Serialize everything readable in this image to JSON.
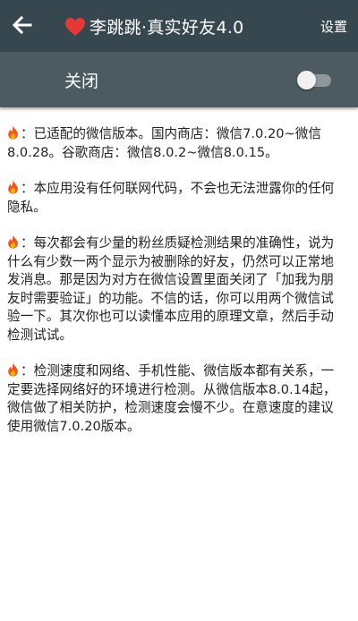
{
  "header": {
    "title": "李跳跳·真实好友4.0",
    "settings_label": "设置",
    "bar_color": "#37474f",
    "heart_color": "#e53935",
    "icons": {
      "back": "arrow-left-icon",
      "title": "heart-icon"
    }
  },
  "switch_bar": {
    "label": "关闭",
    "toggle_on": false
  },
  "notes": [
    {
      "icon": "fire-icon",
      "text": "：已适配的微信版本。国内商店：微信7.0.20~微信8.0.28。谷歌商店：微信8.0.2~微信8.0.15。"
    },
    {
      "icon": "fire-icon",
      "text": "：本应用没有任何联网代码，不会也无法泄露你的任何隐私。"
    },
    {
      "icon": "fire-icon",
      "text": "：每次都会有少量的粉丝质疑检测结果的准确性，说为什么有少数一两个显示为被删除的好友，仍然可以正常地发消息。那是因为对方在微信设置里面关闭了「加我为朋友时需要验证」的功能。不信的话，你可以用两个微信试验一下。其次你也可以读懂本应用的原理文章，然后手动检测试试。"
    },
    {
      "icon": "fire-icon",
      "text": "：检测速度和网络、手机性能、微信版本都有关系，一定要选择网络好的环境进行检测。从微信版本8.0.14起，微信做了相关防护，检测速度会慢不少。在意速度的建议使用微信7.0.20版本。"
    }
  ]
}
